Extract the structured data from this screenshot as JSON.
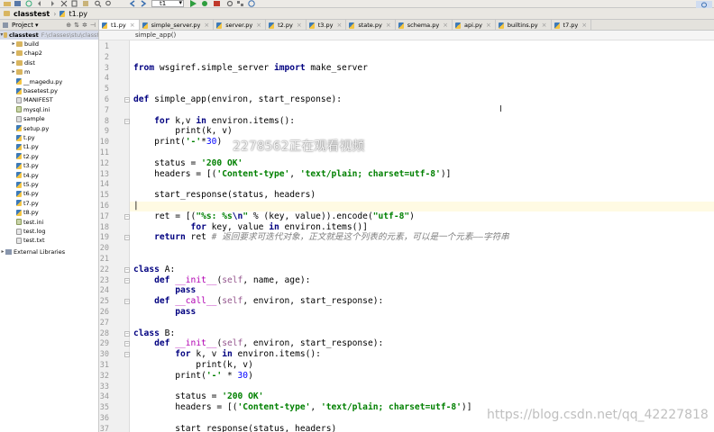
{
  "breadcrumb": [
    {
      "label": "classtest",
      "icon": "folder-icon"
    },
    {
      "label": "t1.py",
      "icon": "python-file-icon"
    }
  ],
  "run_config": {
    "label": "t1"
  },
  "project_panel": {
    "title": "Project",
    "root": {
      "label": "classtest",
      "path": "F:\\classes\\stu\\classt"
    },
    "items": [
      {
        "label": "build",
        "type": "folder"
      },
      {
        "label": "chap2",
        "type": "folder"
      },
      {
        "label": "dist",
        "type": "folder"
      },
      {
        "label": "m",
        "type": "folder"
      },
      {
        "label": "__magedu.py",
        "type": "py"
      },
      {
        "label": "basetest.py",
        "type": "py"
      },
      {
        "label": "MANIFEST",
        "type": "other"
      },
      {
        "label": "mysql.ini",
        "type": "ini"
      },
      {
        "label": "sample",
        "type": "other"
      },
      {
        "label": "setup.py",
        "type": "py"
      },
      {
        "label": "t.py",
        "type": "py"
      },
      {
        "label": "t1.py",
        "type": "py"
      },
      {
        "label": "t2.py",
        "type": "py"
      },
      {
        "label": "t3.py",
        "type": "py"
      },
      {
        "label": "t4.py",
        "type": "py"
      },
      {
        "label": "t5.py",
        "type": "py"
      },
      {
        "label": "t6.py",
        "type": "py"
      },
      {
        "label": "t7.py",
        "type": "py"
      },
      {
        "label": "t8.py",
        "type": "py"
      },
      {
        "label": "test.ini",
        "type": "ini"
      },
      {
        "label": "test.log",
        "type": "txt"
      },
      {
        "label": "test.txt",
        "type": "txt"
      }
    ],
    "external": "External Libraries"
  },
  "tabs": [
    {
      "label": "t1.py",
      "active": true
    },
    {
      "label": "simple_server.py",
      "active": false
    },
    {
      "label": "server.py",
      "active": false
    },
    {
      "label": "t2.py",
      "active": false
    },
    {
      "label": "t3.py",
      "active": false
    },
    {
      "label": "state.py",
      "active": false
    },
    {
      "label": "schema.py",
      "active": false
    },
    {
      "label": "api.py",
      "active": false
    },
    {
      "label": "builtins.py",
      "active": false
    },
    {
      "label": "t7.py",
      "active": false
    }
  ],
  "editor": {
    "method_breadcrumb": "simple_app()",
    "current_line": 16,
    "lines": [
      {
        "n": "1",
        "t": ""
      },
      {
        "n": "2",
        "t": ""
      },
      {
        "n": "3",
        "t": "<span class=\"kw\">from</span> wsgiref.simple_server <span class=\"kw\">import</span> make_server"
      },
      {
        "n": "4",
        "t": ""
      },
      {
        "n": "5",
        "t": ""
      },
      {
        "n": "6",
        "t": "<span class=\"kw\">def</span> simple_app(environ, start_response):"
      },
      {
        "n": "7",
        "t": ""
      },
      {
        "n": "8",
        "t": "    <span class=\"kw\">for</span> k,v <span class=\"kw\">in</span> environ.items():"
      },
      {
        "n": "9",
        "t": "        print(k, v)"
      },
      {
        "n": "10",
        "t": "    print(<span class=\"str\">'-'</span>*<span class=\"num\">30</span>)"
      },
      {
        "n": "11",
        "t": ""
      },
      {
        "n": "12",
        "t": "    status = <span class=\"str\">'200 OK'</span>"
      },
      {
        "n": "13",
        "t": "    headers = [(<span class=\"str\">'Content-type'</span>, <span class=\"str\">'text/plain; charset=utf-8'</span>)]"
      },
      {
        "n": "14",
        "t": ""
      },
      {
        "n": "15",
        "t": "    start_response(status, headers)"
      },
      {
        "n": "16",
        "t": "|"
      },
      {
        "n": "17",
        "t": "    ret = [(<span class=\"str\">\"%s: %s<span class=\"esc\">\\n</span>\"</span> % (key, value)).encode(<span class=\"str\">\"utf-8\"</span>)"
      },
      {
        "n": "18",
        "t": "           <span class=\"kw\">for</span> key, value <span class=\"kw\">in</span> environ.items()]"
      },
      {
        "n": "19",
        "t": "    <span class=\"kw\">return</span> ret <span class=\"cmt\"># 返回要求可迭代对象，正文就是这个列表的元素，可以是一个元素——字符串</span>"
      },
      {
        "n": "20",
        "t": ""
      },
      {
        "n": "21",
        "t": ""
      },
      {
        "n": "22",
        "t": "<span class=\"kw\">class</span> A:"
      },
      {
        "n": "23",
        "t": "    <span class=\"kw\">def</span> <span class=\"dunder\">__init__</span>(<span class=\"selfp\">self</span>, name, age):"
      },
      {
        "n": "24",
        "t": "        <span class=\"kw\">pass</span>"
      },
      {
        "n": "25",
        "t": "    <span class=\"kw\">def</span> <span class=\"dunder\">__call__</span>(<span class=\"selfp\">self</span>, environ, start_response):"
      },
      {
        "n": "26",
        "t": "        <span class=\"kw\">pass</span>"
      },
      {
        "n": "27",
        "t": ""
      },
      {
        "n": "28",
        "t": "<span class=\"kw\">class</span> B:"
      },
      {
        "n": "29",
        "t": "    <span class=\"kw\">def</span> <span class=\"dunder\">__init__</span>(<span class=\"selfp\">self</span>, environ, start_response):"
      },
      {
        "n": "30",
        "t": "        <span class=\"kw\">for</span> k, v <span class=\"kw\">in</span> environ.items():"
      },
      {
        "n": "31",
        "t": "            print(k, v)"
      },
      {
        "n": "32",
        "t": "        print(<span class=\"str\">'-'</span> * <span class=\"num\">30</span>)"
      },
      {
        "n": "33",
        "t": ""
      },
      {
        "n": "34",
        "t": "        status = <span class=\"str\">'200 OK'</span>"
      },
      {
        "n": "35",
        "t": "        headers = [(<span class=\"str\">'Content-type'</span>, <span class=\"str\">'text/plain; charset=utf-8'</span>)]"
      },
      {
        "n": "36",
        "t": ""
      },
      {
        "n": "37",
        "t": "        start_response(status, headers)"
      }
    ]
  },
  "watermarks": {
    "overlay": "2278562正在观看视频",
    "corner": "https://blog.csdn.net/qq_42227818"
  },
  "colors": {
    "keyword": "#000080",
    "string": "#008000",
    "number": "#0000ff",
    "comment": "#808080"
  }
}
